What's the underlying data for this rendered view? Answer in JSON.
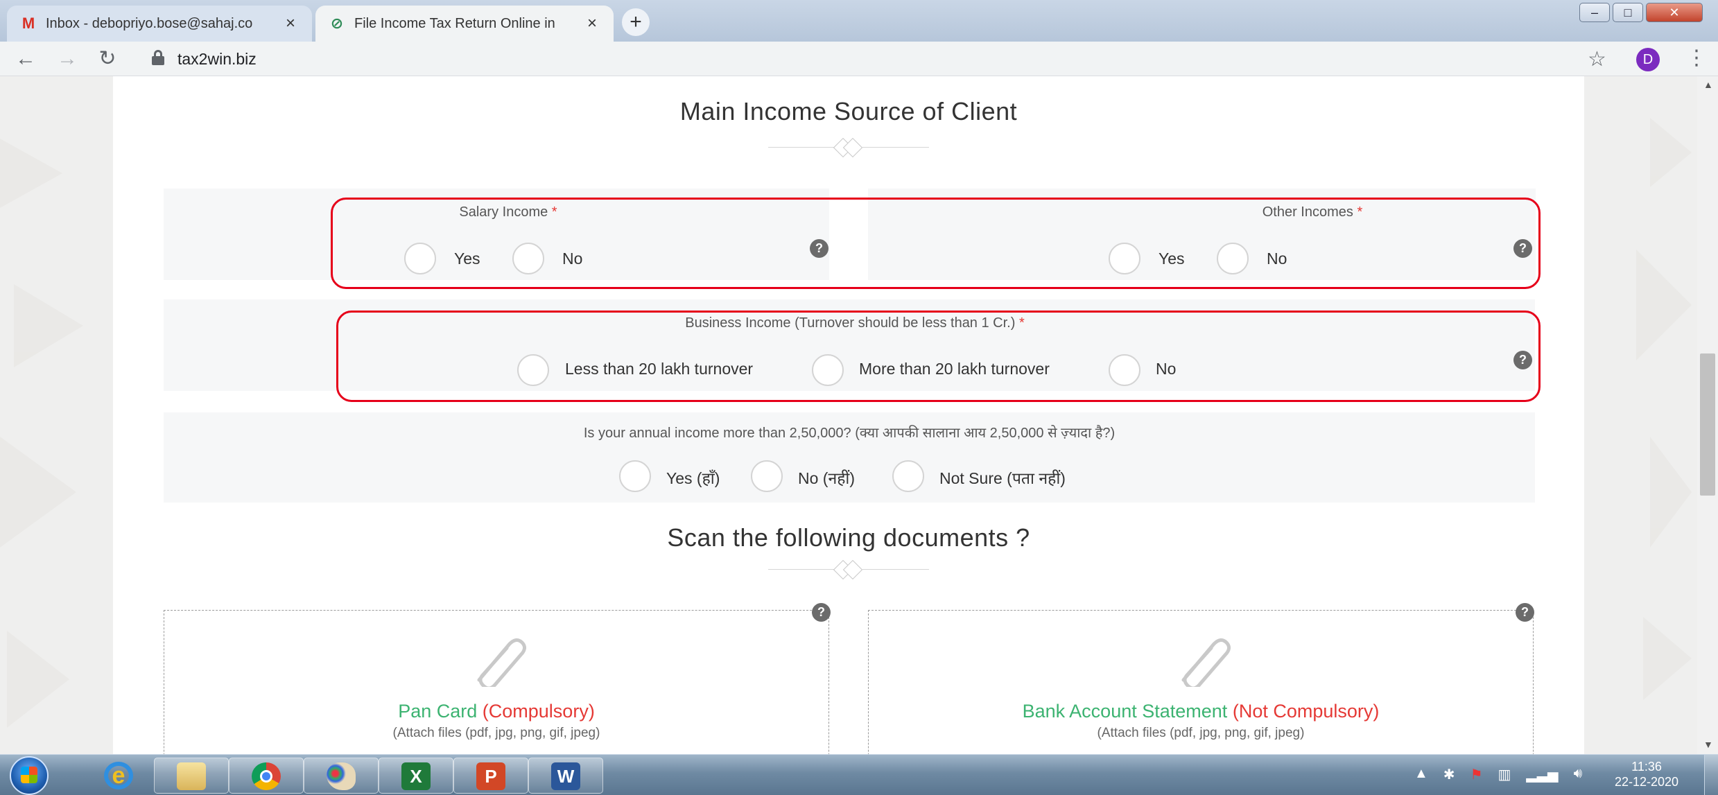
{
  "browser": {
    "tabs": [
      {
        "title": "Inbox - debopriyo.bose@sahaj.co",
        "icon": "gmail-icon",
        "active": false
      },
      {
        "title": "File Income Tax Return Online in",
        "icon": "tax2win-icon",
        "active": true
      }
    ],
    "new_tab": "+",
    "url": "tax2win.biz",
    "profile_initial": "D"
  },
  "page": {
    "income_section_title": "Main Income Source of Client",
    "salary": {
      "label": "Salary Income",
      "required_mark": "*",
      "options": [
        "Yes",
        "No"
      ]
    },
    "other": {
      "label": "Other Incomes",
      "required_mark": "*",
      "options": [
        "Yes",
        "No"
      ]
    },
    "business": {
      "label": "Business Income (Turnover should be less than 1 Cr.)",
      "required_mark": "*",
      "options": [
        "Less than 20 lakh turnover",
        "More than 20 lakh turnover",
        "No"
      ]
    },
    "annual": {
      "label": "Is your annual income more than 2,50,000? (क्या आपकी सालाना आय 2,50,000 से ज़्यादा है?)",
      "options": [
        "Yes (हाँ)",
        "No (नहीं)",
        "Not Sure (पता नहीं)"
      ]
    },
    "help_glyph": "?",
    "scan_section_title": "Scan the following documents ?",
    "documents": [
      {
        "name": "Pan Card",
        "status": "(Compulsory)",
        "hint": "(Attach files (pdf, jpg, png, gif, jpeg)"
      },
      {
        "name": "Bank Account Statement",
        "status": "(Not Compulsory)",
        "hint": "(Attach files (pdf, jpg, png, gif, jpeg)"
      }
    ]
  },
  "taskbar": {
    "time": "11:36",
    "date": "22-12-2020",
    "pinned": [
      "internet-explorer-icon",
      "file-explorer-icon",
      "chrome-icon",
      "paint-icon",
      "excel-icon",
      "powerpoint-icon",
      "word-icon"
    ]
  }
}
